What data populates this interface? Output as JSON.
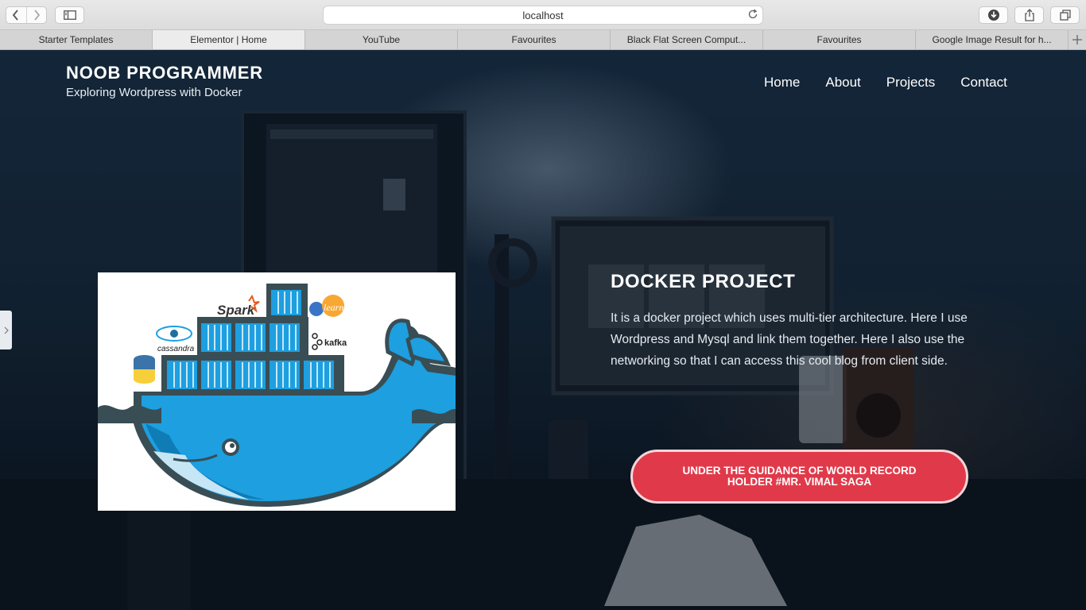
{
  "browser": {
    "address": "localhost",
    "tabs": [
      {
        "label": "Starter Templates",
        "active": false
      },
      {
        "label": "Elementor | Home",
        "active": true
      },
      {
        "label": "YouTube",
        "active": false
      },
      {
        "label": "Favourites",
        "active": false
      },
      {
        "label": "Black Flat Screen Comput...",
        "active": false
      },
      {
        "label": "Favourites",
        "active": false
      },
      {
        "label": "Google Image Result for h...",
        "active": false
      }
    ],
    "icons": [
      "back-icon",
      "forward-icon",
      "sidebar-icon",
      "reload-icon",
      "download-icon",
      "share-icon",
      "tabs-overview-icon",
      "new-tab-icon"
    ]
  },
  "site": {
    "title": "NOOB PROGRAMMER",
    "tagline": "Exploring Wordpress with Docker",
    "nav": [
      "Home",
      "About",
      "Projects",
      "Contact"
    ]
  },
  "project": {
    "title": "DOCKER PROJECT",
    "description": "It is a docker project which uses multi-tier architecture. Here I use Wordpress and Mysql and link them together. Here I also use the networking so that I can access this cool blog from client side.",
    "image_labels": {
      "spark": "Spark",
      "learn": "learn",
      "cassandra": "cassandra",
      "kafka": "kafka"
    },
    "cta": "UNDER THE GUIDANCE OF WORLD RECORD HOLDER #MR. VIMAL SAGA"
  },
  "colors": {
    "accent": "#e03a4a",
    "docker_blue": "#1d9fe0",
    "docker_dark": "#394d54"
  }
}
